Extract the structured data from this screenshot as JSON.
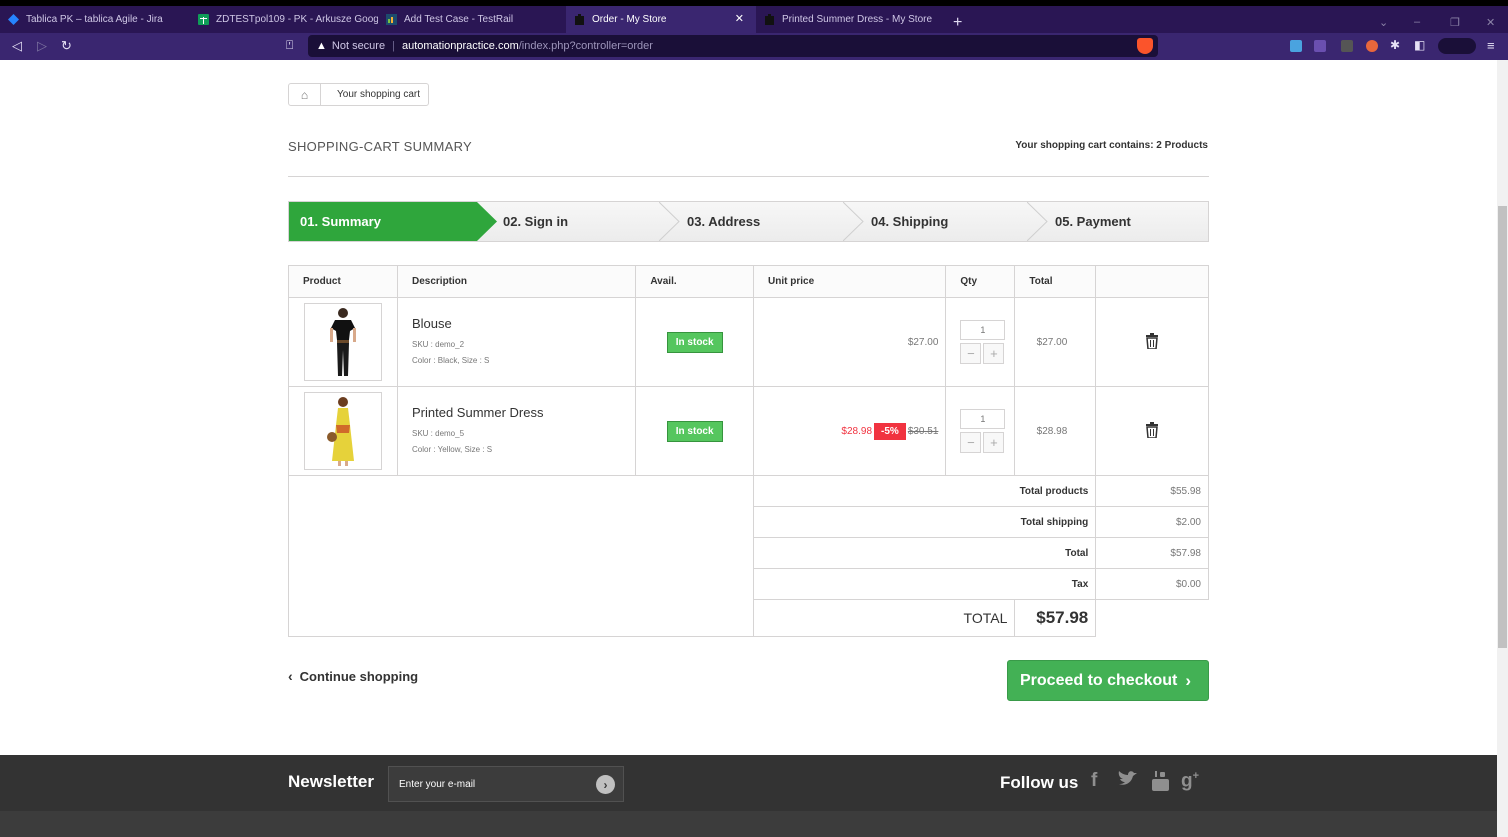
{
  "browser": {
    "tabs": [
      {
        "title": "Tablica PK – tablica Agile - Jira",
        "active": false
      },
      {
        "title": "ZDTESTpol109 - PK - Arkusze Google",
        "active": false
      },
      {
        "title": "Add Test Case - TestRail",
        "active": false
      },
      {
        "title": "Order - My Store",
        "active": true
      },
      {
        "title": "Printed Summer Dress - My Store",
        "active": false
      }
    ],
    "new_tab": "+",
    "not_secure": "Not secure",
    "url_host": "automationpractice.com",
    "url_path": "/index.php?controller=order"
  },
  "breadcrumb": {
    "current": "Your shopping cart"
  },
  "summary": {
    "title": "SHOPPING-CART SUMMARY",
    "cart_count": "Your shopping cart contains: 2 Products"
  },
  "steps": [
    "01. Summary",
    "02. Sign in",
    "03. Address",
    "04. Shipping",
    "05. Payment"
  ],
  "table": {
    "headers": [
      "Product",
      "Description",
      "Avail.",
      "Unit price",
      "Qty",
      "Total",
      ""
    ],
    "rows": [
      {
        "name": "Blouse",
        "sku": "SKU : demo_2",
        "attrs": "Color : Black, Size : S",
        "avail": "In stock",
        "price": "$27.00",
        "qty": "1",
        "total": "$27.00"
      },
      {
        "name": "Printed Summer Dress",
        "sku": "SKU : demo_5",
        "attrs": "Color : Yellow, Size : S",
        "avail": "In stock",
        "price": "$28.98",
        "discount": "-5%",
        "old_price": "$30.51",
        "qty": "1",
        "total": "$28.98"
      }
    ],
    "totals": {
      "products_label": "Total products",
      "products": "$55.98",
      "shipping_label": "Total shipping",
      "shipping": "$2.00",
      "total_label": "Total",
      "total": "$57.98",
      "tax_label": "Tax",
      "tax": "$0.00",
      "grand_label": "TOTAL",
      "grand": "$57.98"
    }
  },
  "actions": {
    "continue": "Continue shopping",
    "checkout": "Proceed to checkout"
  },
  "footer": {
    "newsletter": "Newsletter",
    "email_placeholder": "Enter your e-mail",
    "follow": "Follow us"
  },
  "colors": {
    "accent_green": "#43b155",
    "stock_green": "#55c65e",
    "discount_red": "#f13340",
    "browser_purple": "#3a2670"
  }
}
